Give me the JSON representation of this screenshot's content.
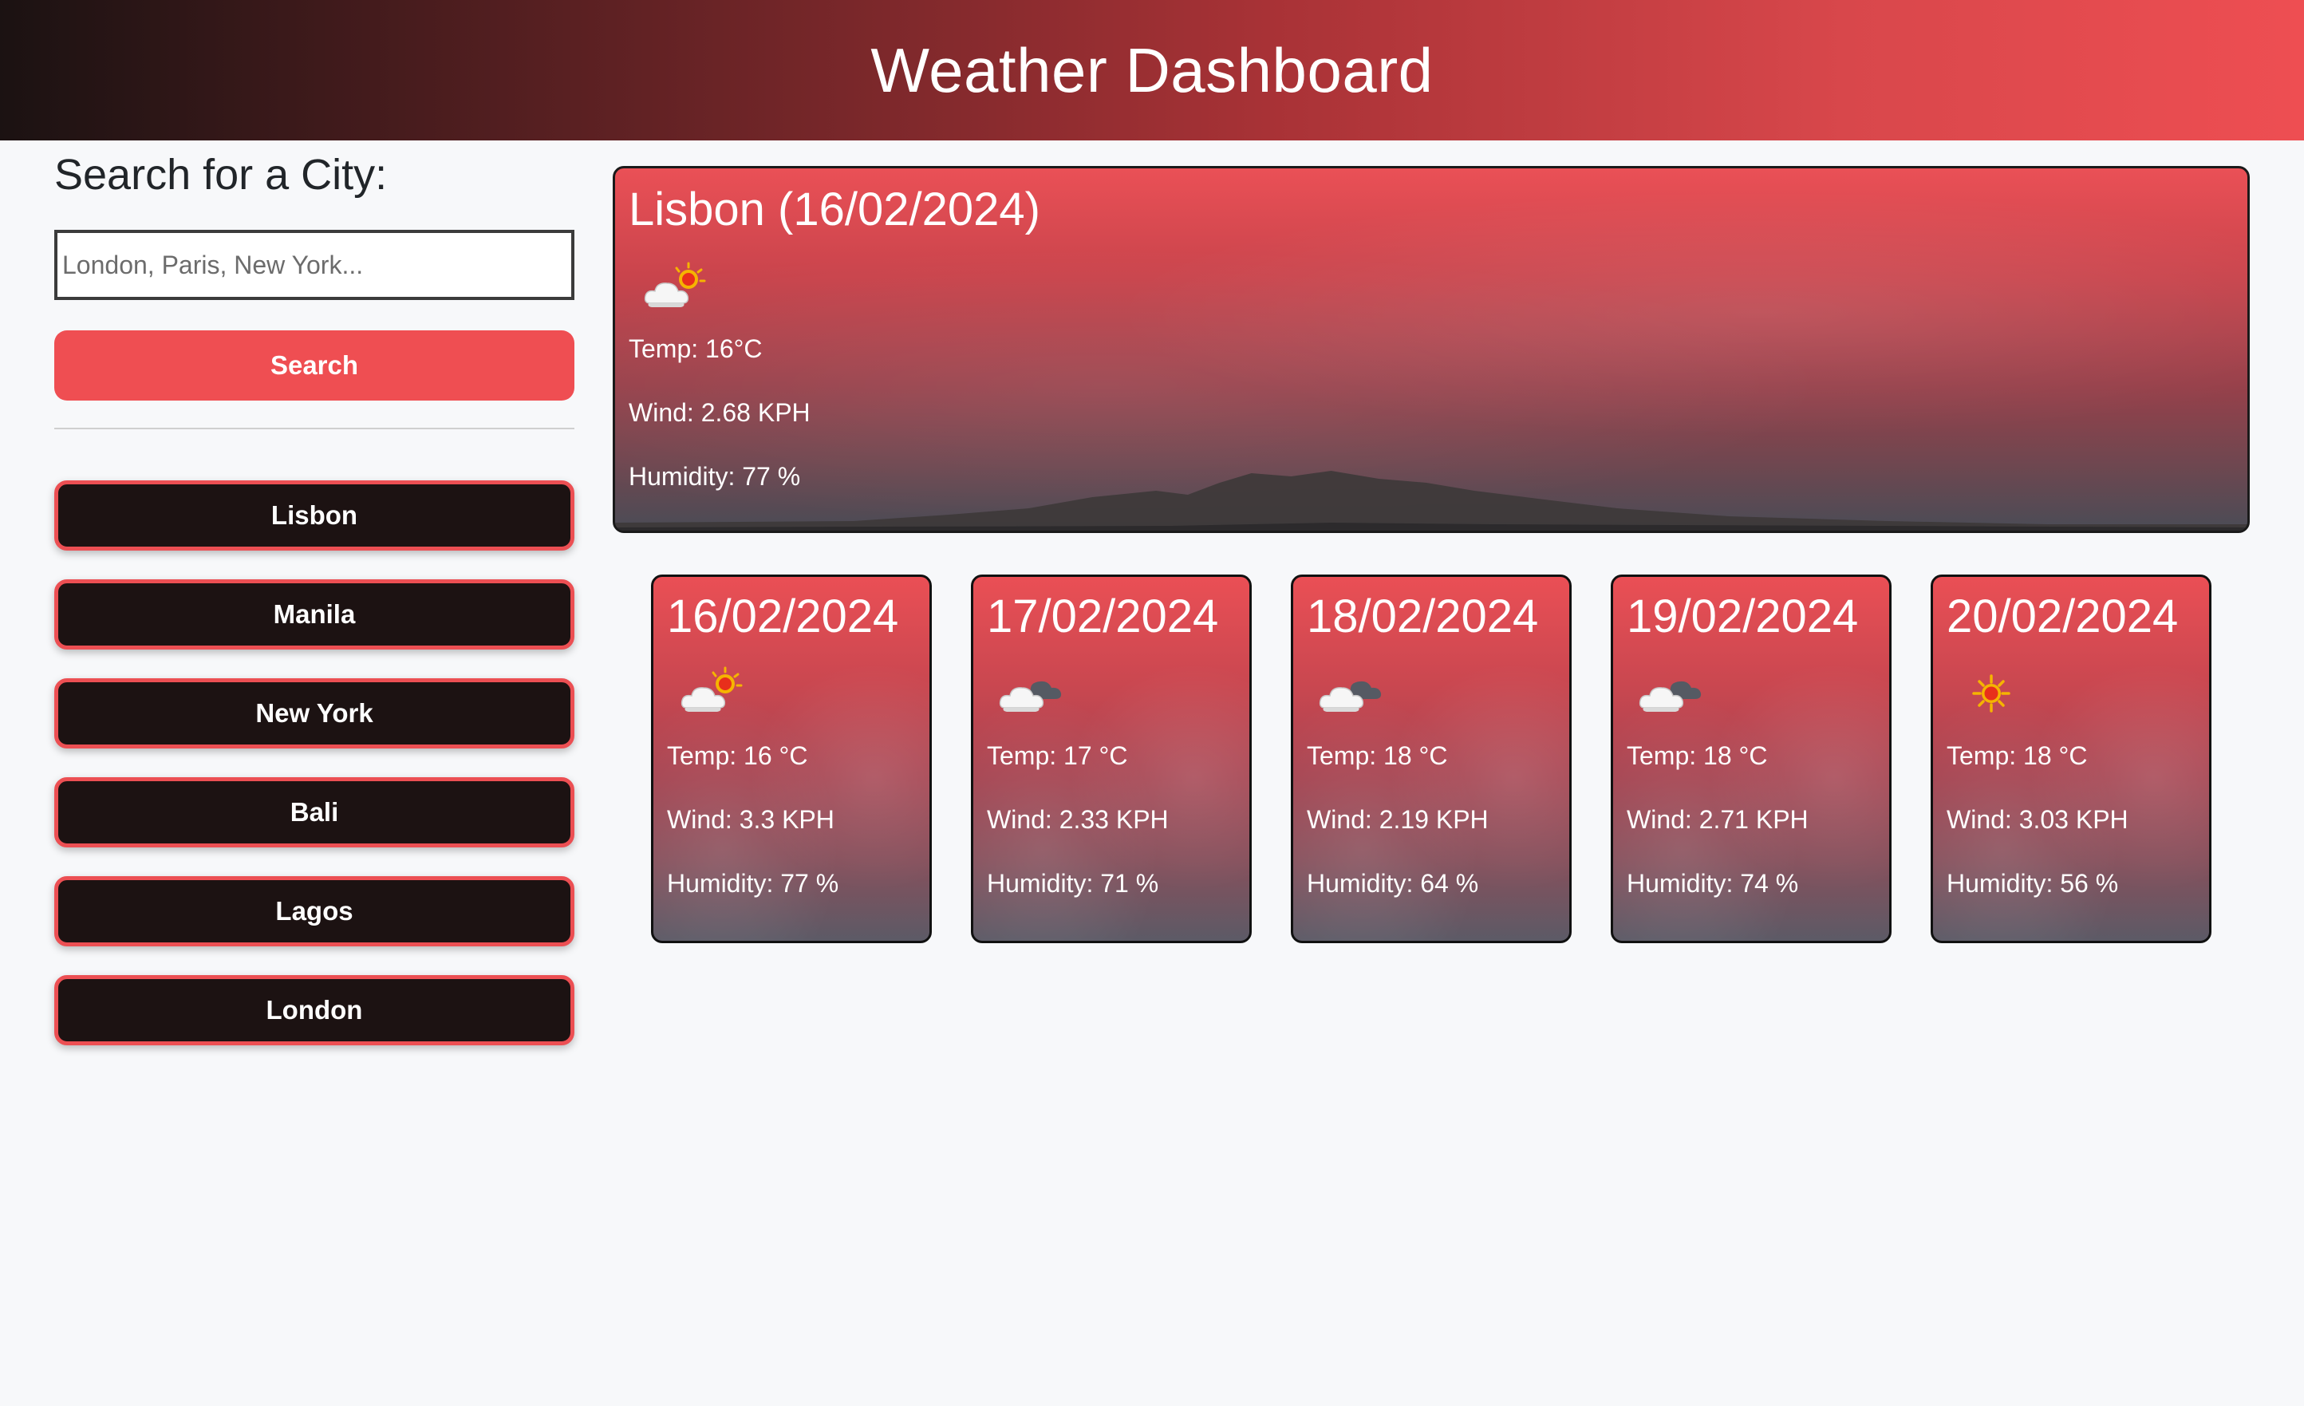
{
  "header": {
    "title": "Weather Dashboard"
  },
  "search": {
    "title": "Search for a City:",
    "placeholder": "London, Paris, New York...",
    "value": "",
    "button_label": "Search"
  },
  "history": [
    "Lisbon",
    "Manila",
    "New York",
    "Bali",
    "Lagos",
    "London"
  ],
  "current": {
    "title": "Lisbon (16/02/2024)",
    "icon": "sun-behind-cloud-icon",
    "temp": "Temp: 16°C",
    "wind": "Wind: 2.68 KPH",
    "humidity": "Humidity: 77 %"
  },
  "forecast": [
    {
      "date": "16/02/2024",
      "icon": "sun-behind-cloud-icon",
      "temp": "Temp: 16 °C",
      "wind": "Wind: 3.3 KPH",
      "humidity": "Humidity: 77 %"
    },
    {
      "date": "17/02/2024",
      "icon": "dark-cloud-icon",
      "temp": "Temp: 17 °C",
      "wind": "Wind: 2.33 KPH",
      "humidity": "Humidity: 71 %"
    },
    {
      "date": "18/02/2024",
      "icon": "dark-cloud-icon",
      "temp": "Temp: 18 °C",
      "wind": "Wind: 2.19 KPH",
      "humidity": "Humidity: 64 %"
    },
    {
      "date": "19/02/2024",
      "icon": "dark-cloud-icon",
      "temp": "Temp: 18 °C",
      "wind": "Wind: 2.71 KPH",
      "humidity": "Humidity: 74 %"
    },
    {
      "date": "20/02/2024",
      "icon": "sun-icon",
      "temp": "Temp: 18 °C",
      "wind": "Wind: 3.03 KPH",
      "humidity": "Humidity: 56 %"
    }
  ],
  "colors": {
    "accent": "#ef4e52",
    "history_bg": "#1c1212",
    "page_bg": "#f7f8fa"
  }
}
